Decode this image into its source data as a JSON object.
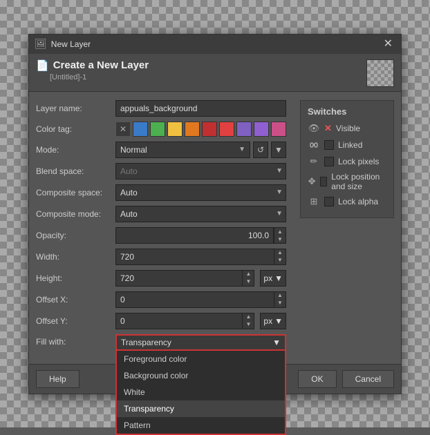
{
  "titlebar": {
    "icon": "🖼",
    "title": "New Layer",
    "close_label": "✕"
  },
  "dialog": {
    "header": {
      "icon": "📄",
      "title": "Create a New Layer",
      "subtitle": "[Untitled]-1"
    },
    "form": {
      "layer_name_label": "Layer name:",
      "layer_name_value": "appuals_background",
      "color_tag_label": "Color tag:",
      "mode_label": "Mode:",
      "mode_value": "Normal",
      "blend_space_label": "Blend space:",
      "blend_space_value": "Auto",
      "composite_space_label": "Composite space:",
      "composite_space_value": "Auto",
      "composite_mode_label": "Composite mode:",
      "composite_mode_value": "Auto",
      "opacity_label": "Opacity:",
      "opacity_value": "100.0",
      "width_label": "Width:",
      "width_value": "720",
      "height_label": "Height:",
      "height_value": "720",
      "offset_x_label": "Offset X:",
      "offset_x_value": "0",
      "offset_y_label": "Offset Y:",
      "offset_y_value": "0",
      "fill_with_label": "Fill with:",
      "fill_with_value": "Transparency"
    },
    "fill_options": [
      {
        "label": "Foreground color",
        "selected": false
      },
      {
        "label": "Background color",
        "selected": false
      },
      {
        "label": "White",
        "selected": false
      },
      {
        "label": "Transparency",
        "selected": true
      },
      {
        "label": "Pattern",
        "selected": false
      }
    ],
    "switches": {
      "title": "Switches",
      "items": [
        {
          "icon": "👁",
          "label": "Visible",
          "has_x": true
        },
        {
          "icon": "🔗",
          "label": "Linked",
          "has_checkbox": true
        },
        {
          "icon": "✏",
          "label": "Lock pixels",
          "has_checkbox": true
        },
        {
          "icon": "✥",
          "label": "Lock position and size",
          "has_checkbox": true
        },
        {
          "icon": "⊞",
          "label": "Lock alpha",
          "has_checkbox": true
        }
      ]
    },
    "footer": {
      "help_label": "Help",
      "ok_label": "OK",
      "cancel_label": "Cancel"
    }
  },
  "colors": {
    "blue": "#3a7bc8",
    "green": "#4caf50",
    "yellow": "#f0c040",
    "orange": "#e07820",
    "red_dark": "#c03030",
    "red": "#e04040",
    "purple": "#8060c0",
    "violet": "#9060d0",
    "pink": "#cc5088"
  },
  "unit": "px"
}
